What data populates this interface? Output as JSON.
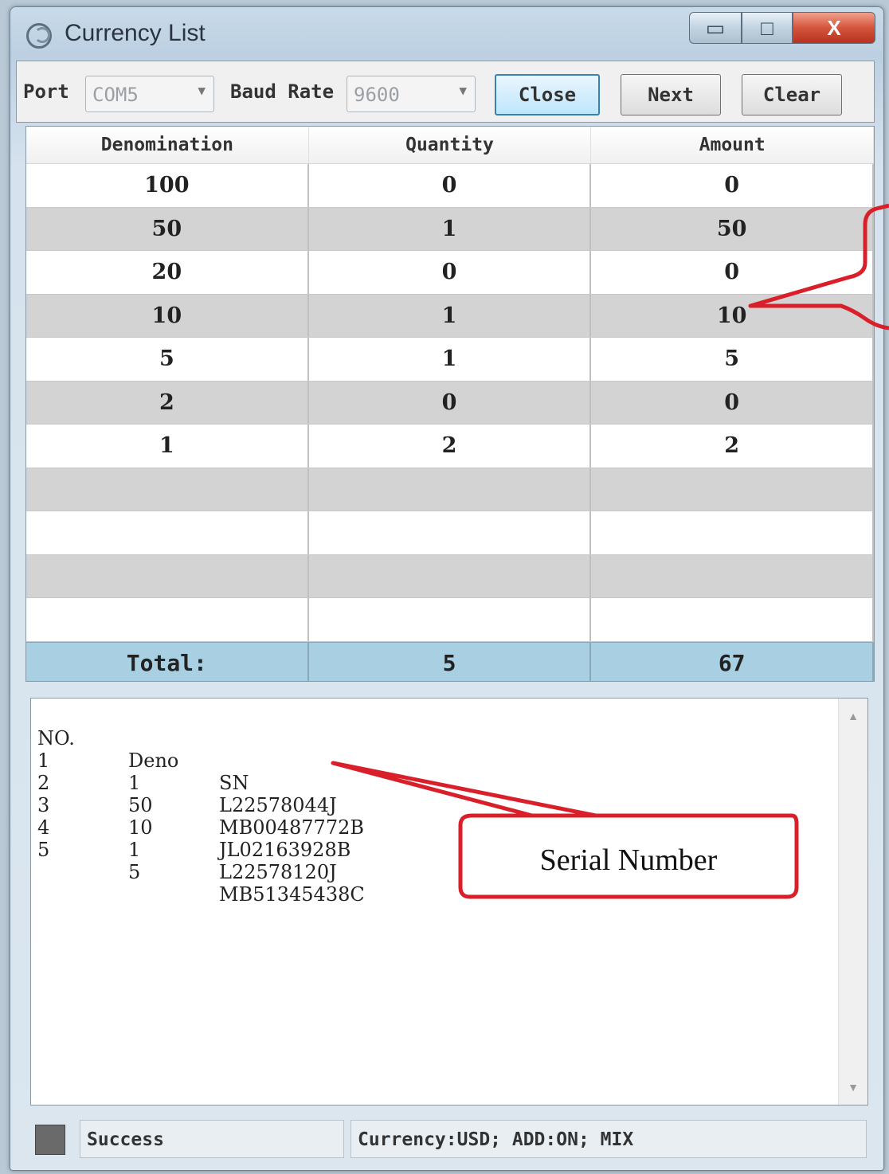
{
  "window": {
    "title": "Currency List",
    "controls": {
      "minimize": "▭",
      "maximize": "□",
      "close": "X"
    }
  },
  "toolbar": {
    "port_label": "Port",
    "port_value": "COM5",
    "baud_label": "Baud Rate",
    "baud_value": "9600",
    "close_label": "Close",
    "next_label": "Next",
    "clear_label": "Clear"
  },
  "table": {
    "headers": [
      "Denomination",
      "Quantity",
      "Amount"
    ],
    "rows": [
      [
        "100",
        "0",
        "0"
      ],
      [
        "50",
        "1",
        "50"
      ],
      [
        "20",
        "0",
        "0"
      ],
      [
        "10",
        "1",
        "10"
      ],
      [
        "5",
        "1",
        "5"
      ],
      [
        "2",
        "0",
        "0"
      ],
      [
        "1",
        "2",
        "2"
      ],
      [
        "",
        "",
        ""
      ],
      [
        "",
        "",
        ""
      ],
      [
        "",
        "",
        ""
      ],
      [
        "",
        "",
        ""
      ]
    ],
    "total": [
      "Total:",
      "5",
      "67"
    ]
  },
  "serials": {
    "headers": [
      "NO.",
      "Deno",
      "SN"
    ],
    "rows": [
      [
        "1",
        "1",
        "L22578044J"
      ],
      [
        "2",
        "50",
        "MB00487772B"
      ],
      [
        "3",
        "10",
        "JL02163928B"
      ],
      [
        "4",
        "1",
        "L22578120J"
      ],
      [
        "5",
        "5",
        "MB51345438C"
      ]
    ]
  },
  "annotation": {
    "label": "Serial Number",
    "color": "#d9202a"
  },
  "status": {
    "message": "Success",
    "info": "Currency:USD; ADD:ON; MIX"
  }
}
